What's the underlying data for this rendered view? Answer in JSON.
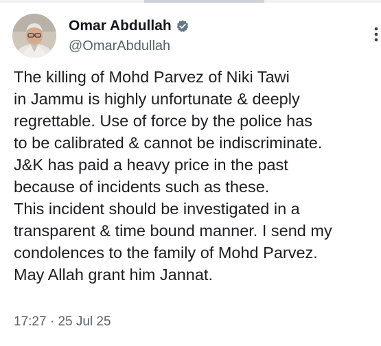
{
  "tweet": {
    "author": {
      "display_name": "Omar Abdullah",
      "handle": "@OmarAbdullah",
      "verified_icon": "verified-badge-icon",
      "verified_color": "#657786"
    },
    "text_lines": [
      "The killing of Mohd Parvez of Niki Tawi",
      "in Jammu is highly unfortunate & deeply",
      "regrettable. Use of force by the police has",
      "to be calibrated & cannot be indiscriminate.",
      "J&K has paid a heavy price in the past",
      "because of incidents such as these.",
      "This incident should be investigated in a",
      "transparent & time bound manner. I send my",
      "condolences to the family of Mohd Parvez.",
      "May Allah grant him Jannat."
    ],
    "time": "17:27",
    "separator": "·",
    "date": "25 Jul 25",
    "more_icon": "more-options-icon"
  }
}
